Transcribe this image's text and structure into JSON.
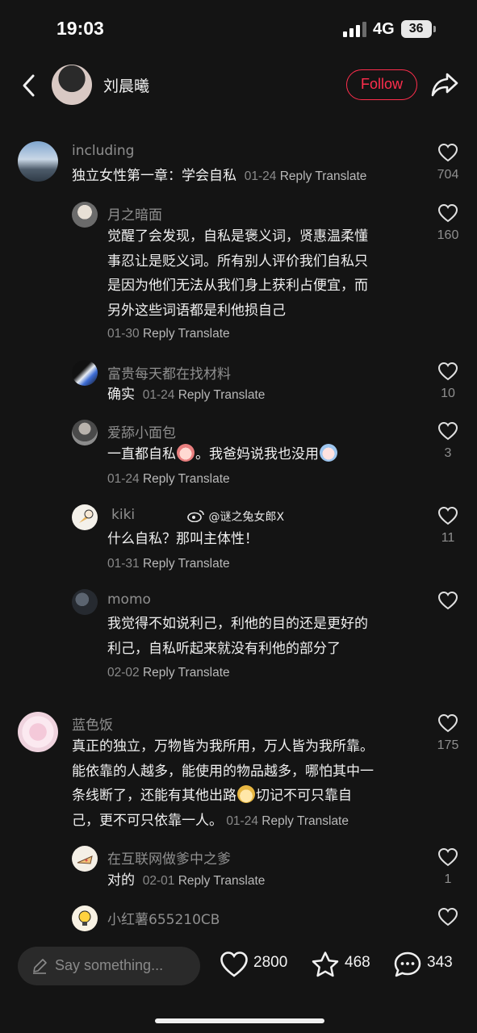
{
  "status_bar": {
    "time": "19:03",
    "network": "4G",
    "battery": "36"
  },
  "header": {
    "title": "刘晨曦",
    "follow_label": "Follow"
  },
  "comments": [
    {
      "user": "including",
      "text": "独立女性第一章：学会自私",
      "date": "01-24",
      "reply": "Reply",
      "translate": "Translate",
      "likes": "704",
      "replies": [
        {
          "user": "月之暗面",
          "lines": [
            "觉醒了会发现，自私是褒义词，贤惠温柔懂",
            "事忍让是贬义词。所有别人评价我们自私只",
            "是因为他们无法从我们身上获利占便宜，而",
            "另外这些词语都是利他损自己"
          ],
          "date": "01-30",
          "reply": "Reply",
          "translate": "Translate",
          "likes": "160"
        },
        {
          "user": "富贵每天都在找材料",
          "text": "确实",
          "date": "01-24",
          "reply": "Reply",
          "translate": "Translate",
          "likes": "10"
        },
        {
          "user": "爱舔小面包",
          "text_a": "一直都自私",
          "text_b": "。我爸妈说我也没用",
          "date": "01-24",
          "reply": "Reply",
          "translate": "Translate",
          "likes": "3"
        },
        {
          "user": "kiki",
          "text": "什么自私？那叫主体性！",
          "date": "01-31",
          "reply": "Reply",
          "translate": "Translate",
          "likes": "11"
        },
        {
          "user": "momo",
          "lines": [
            "我觉得不如说利己，利他的目的还是更好的",
            "利己，自私听起来就没有利他的部分了"
          ],
          "date": "02-02",
          "reply": "Reply",
          "translate": "Translate",
          "likes": ""
        }
      ]
    },
    {
      "user": "蓝色饭",
      "lines": [
        "真正的独立，万物皆为我所用，万人皆为我所靠。",
        "能依靠的人越多，能使用的物品越多，哪怕其中一",
        "条线断了，还能有其他出路",
        "切记不可只靠自",
        "己，更不可只依靠一人。"
      ],
      "date": "01-24",
      "reply": "Reply",
      "translate": "Translate",
      "likes": "175",
      "replies": [
        {
          "user": "在互联网做爹中之爹",
          "text": "对的",
          "date": "02-01",
          "reply": "Reply",
          "translate": "Translate",
          "likes": "1"
        },
        {
          "user": "小红薯655210CB",
          "likes": ""
        }
      ]
    }
  ],
  "watermark": "@谜之兔女郎X",
  "bottom_bar": {
    "input_placeholder": "Say something...",
    "likes": "2800",
    "collects": "468",
    "comments": "343"
  },
  "colors": {
    "background": "#141414",
    "accent": "#ff2e4d",
    "muted_text": "#8f8f8f"
  },
  "icons": [
    "back-icon",
    "share-icon",
    "heart-icon",
    "star-icon",
    "comment-bubble-icon",
    "pencil-icon",
    "weibo-icon"
  ]
}
